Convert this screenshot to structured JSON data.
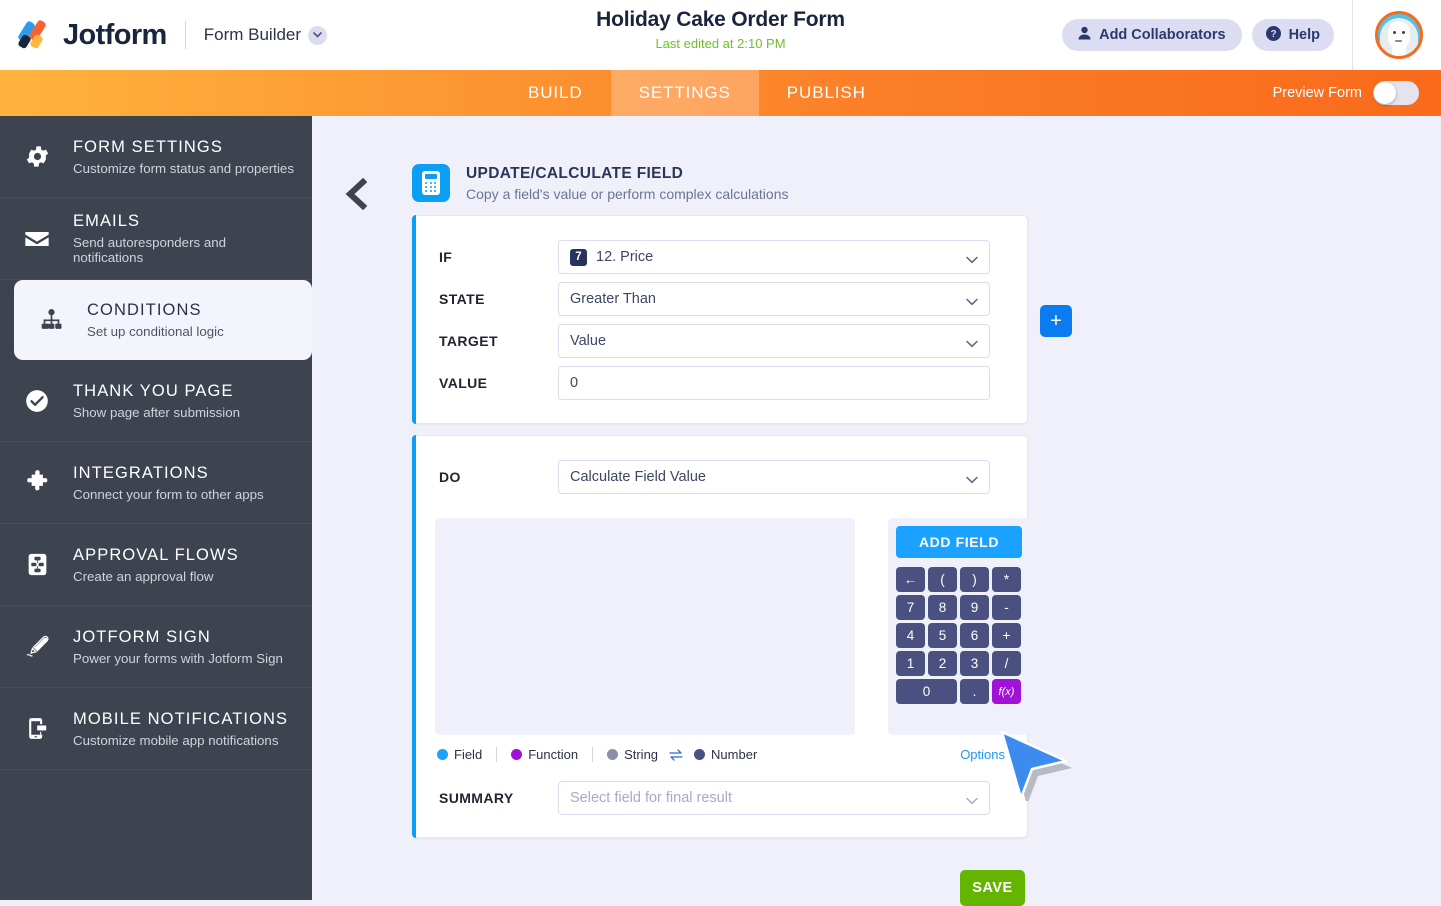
{
  "header": {
    "brand_name": "Jotform",
    "product_label": "Form Builder",
    "form_title": "Holiday Cake Order Form",
    "last_edited": "Last edited at 2:10 PM",
    "add_collaborators_label": "Add Collaborators",
    "help_label": "Help",
    "icons": {
      "chevron_down": "chevron-down-icon",
      "person": "person-icon",
      "question": "question-circle-icon",
      "avatar": "user-avatar"
    }
  },
  "navbar": {
    "tabs": [
      {
        "label": "BUILD",
        "active": false
      },
      {
        "label": "SETTINGS",
        "active": true
      },
      {
        "label": "PUBLISH",
        "active": false
      }
    ],
    "preview_label": "Preview Form",
    "preview_toggle_on": false
  },
  "sidebar": {
    "items": [
      {
        "title": "FORM SETTINGS",
        "desc": "Customize form status and properties",
        "icon": "gear-icon",
        "active": false
      },
      {
        "title": "EMAILS",
        "desc": "Send autoresponders and notifications",
        "icon": "envelope-icon",
        "active": false
      },
      {
        "title": "CONDITIONS",
        "desc": "Set up conditional logic",
        "icon": "sitemap-icon",
        "active": true
      },
      {
        "title": "THANK YOU PAGE",
        "desc": "Show page after submission",
        "icon": "check-circle-icon",
        "active": false
      },
      {
        "title": "INTEGRATIONS",
        "desc": "Connect your form to other apps",
        "icon": "puzzle-icon",
        "active": false
      },
      {
        "title": "APPROVAL FLOWS",
        "desc": "Create an approval flow",
        "icon": "approval-flow-icon",
        "active": false
      },
      {
        "title": "JOTFORM SIGN",
        "desc": "Power your forms with Jotform Sign",
        "icon": "pen-icon",
        "active": false
      },
      {
        "title": "MOBILE NOTIFICATIONS",
        "desc": "Customize mobile app notifications",
        "icon": "mobile-icon",
        "active": false
      }
    ]
  },
  "panel": {
    "back_icon": "chevron-left-icon",
    "icon": "calculator-icon",
    "title": "UPDATE/CALCULATE FIELD",
    "subtitle": "Copy a field's value or perform complex calculations"
  },
  "condition": {
    "if_label": "IF",
    "if_field_badge": "7",
    "if_field_value": "12. Price",
    "state_label": "STATE",
    "state_value": "Greater Than",
    "target_label": "TARGET",
    "target_value": "Value",
    "value_label": "VALUE",
    "value_value": "0",
    "add_button_label": "+"
  },
  "action": {
    "do_label": "DO",
    "do_value": "Calculate Field Value",
    "expression": "",
    "add_field_label": "ADD FIELD",
    "keys": [
      "←",
      "(",
      ")",
      "*",
      "7",
      "8",
      "9",
      "-",
      "4",
      "5",
      "6",
      "+",
      "1",
      "2",
      "3",
      "/",
      "0",
      ".",
      "f(x)"
    ],
    "legend": [
      {
        "label": "Field",
        "color": "#1ba1ff"
      },
      {
        "label": "Function",
        "color": "#a012d6"
      },
      {
        "label": "String",
        "color": "#8b90a8"
      },
      {
        "label": "Number",
        "color": "#4a5080"
      }
    ],
    "swap_icon": "swap-arrows-icon",
    "options_label": "Options",
    "summary_label": "SUMMARY",
    "summary_placeholder": "Select field for final result"
  },
  "footer": {
    "save_label": "SAVE"
  },
  "colors": {
    "accent_blue": "#0a9ef5",
    "brand_orange": "#f96a1b",
    "save_green": "#63b500",
    "sidebar_dark": "#3d4450",
    "function_purple": "#a012d6",
    "page_bg": "#f0f0fa",
    "cursor_blue": "#3d8bef"
  }
}
